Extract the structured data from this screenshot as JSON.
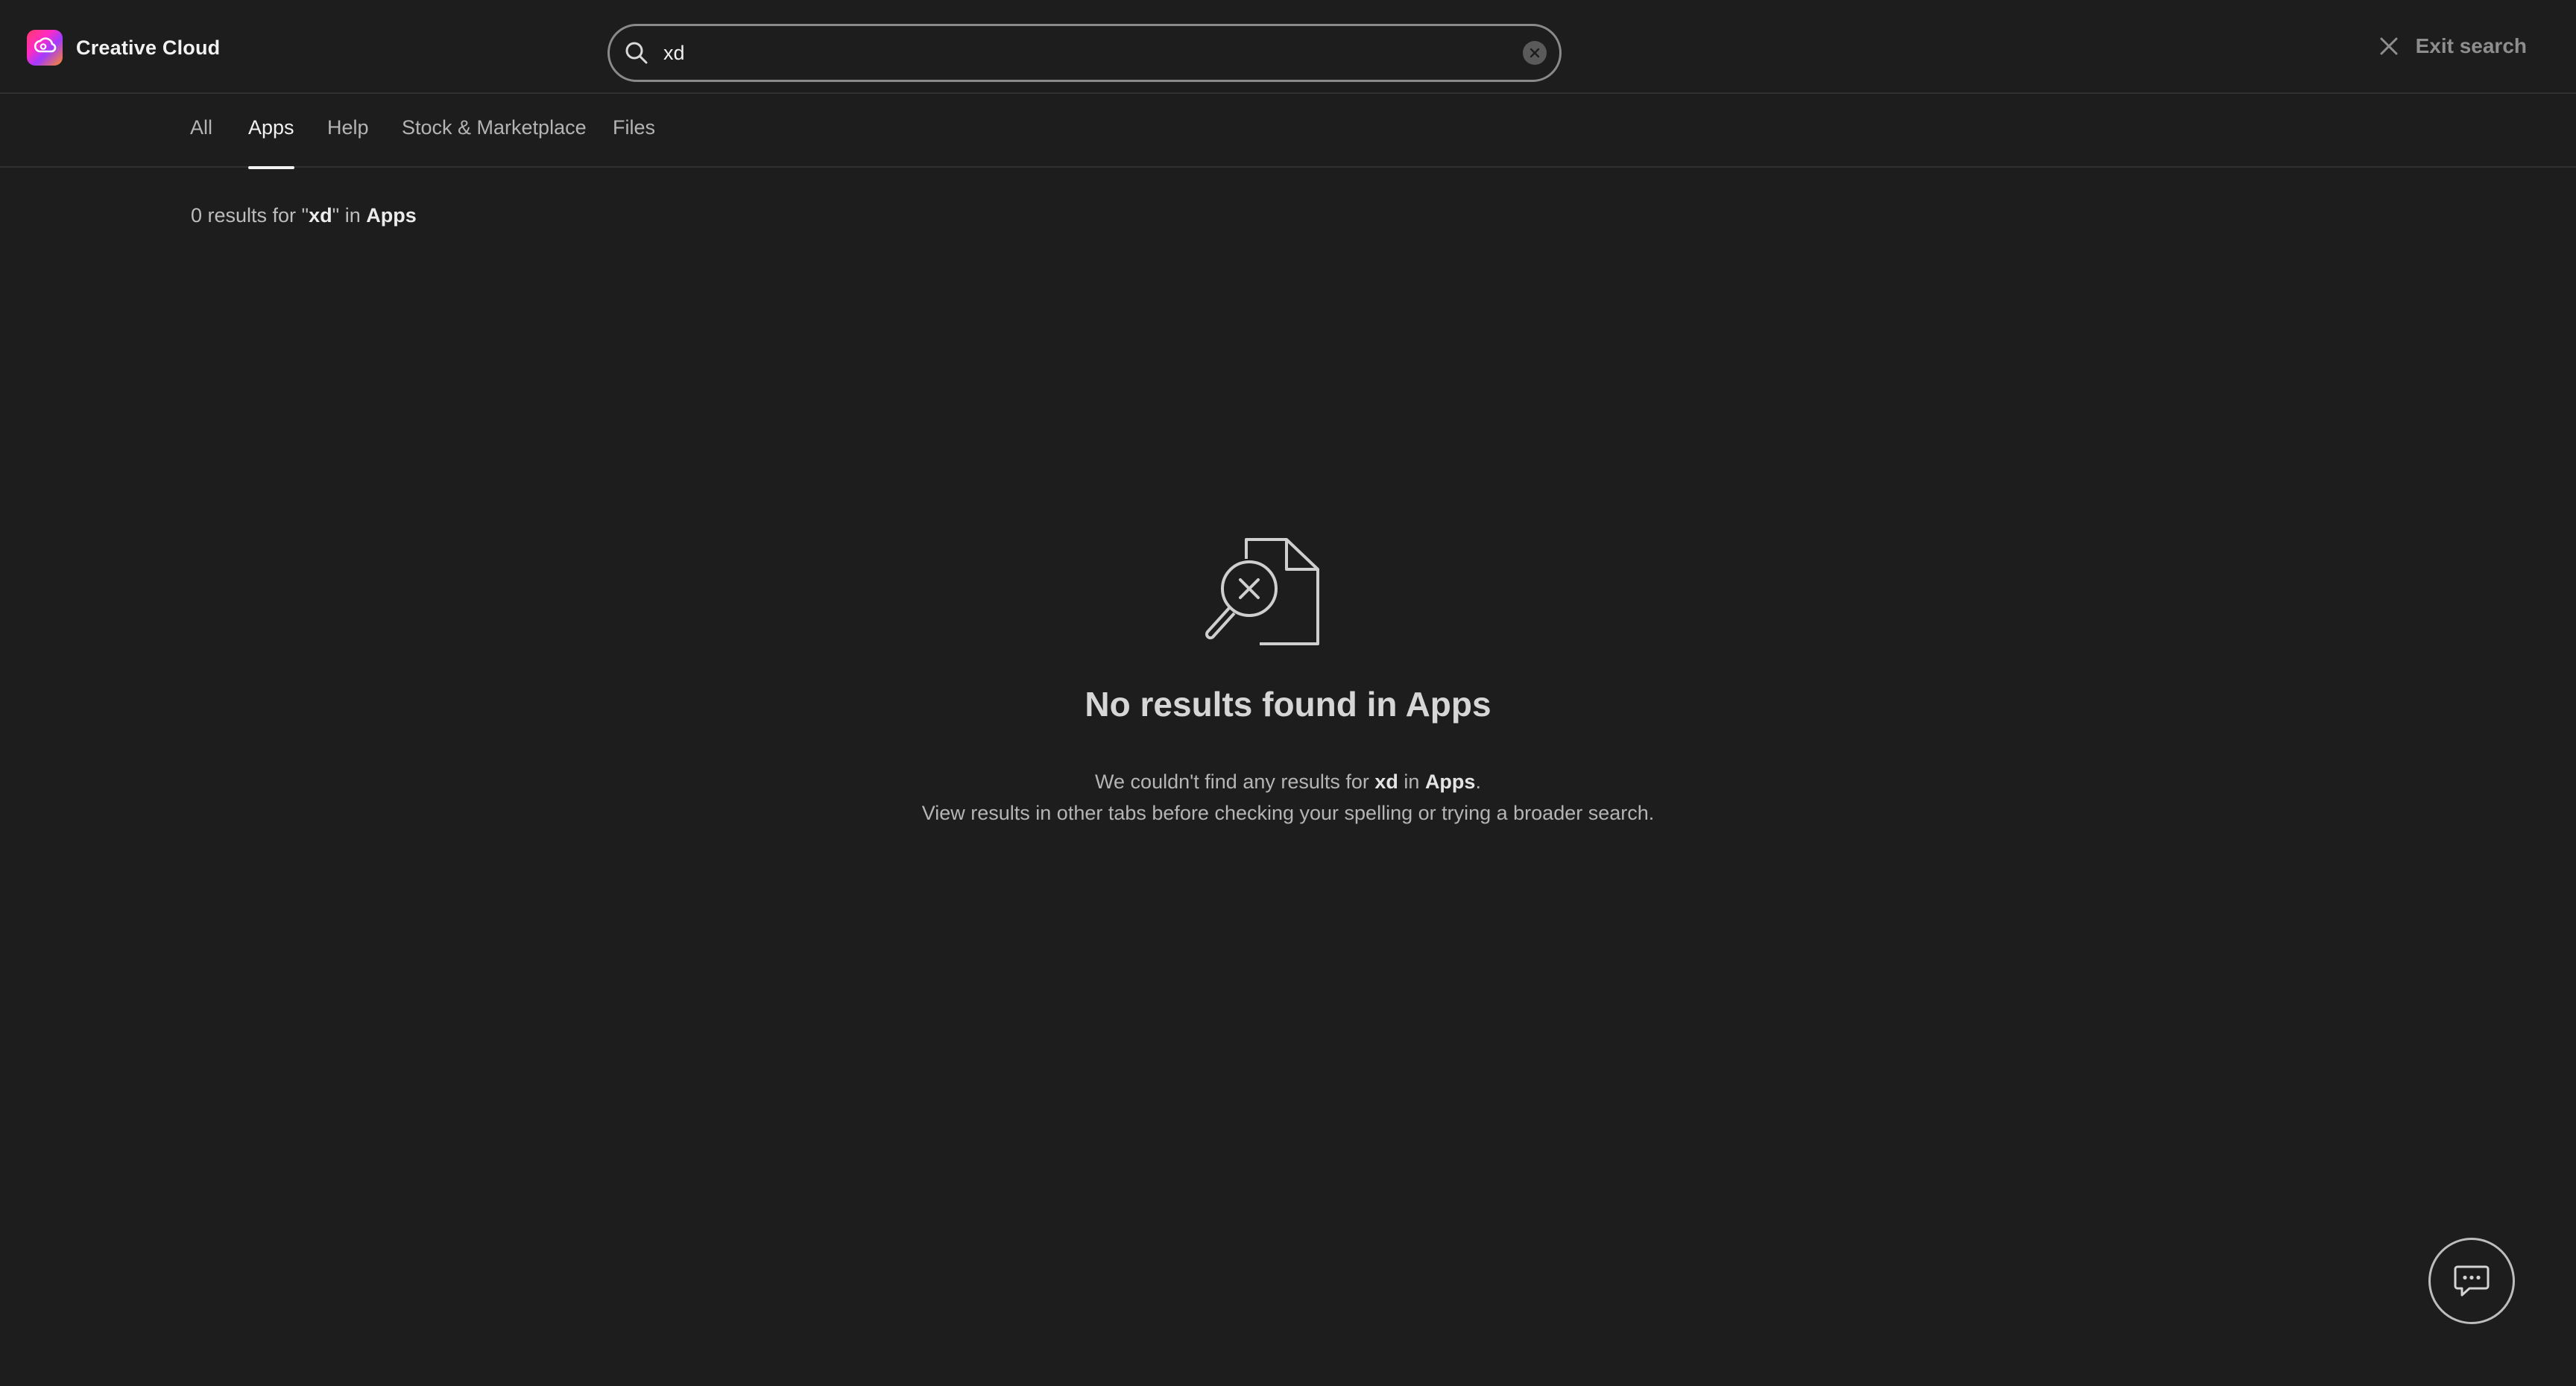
{
  "header": {
    "app_title": "Creative Cloud",
    "logo_icon": "creative-cloud-logo-icon",
    "search": {
      "value": "xd",
      "icon": "search-icon",
      "clear_icon": "clear-icon"
    },
    "exit_search_label": "Exit search"
  },
  "tabs": [
    {
      "label": "All",
      "active": false
    },
    {
      "label": "Apps",
      "active": true
    },
    {
      "label": "Help",
      "active": false
    },
    {
      "label": "Stock & Marketplace",
      "active": false
    },
    {
      "label": "Files",
      "active": false
    }
  ],
  "results_summary": {
    "count_prefix": "0 results for \"",
    "query": "xd",
    "middle": "\" in ",
    "scope": "Apps"
  },
  "empty_state": {
    "icon": "no-results-document-icon",
    "title": "No results found in Apps",
    "line1_prefix": "We couldn't find any results for ",
    "line1_query": "xd",
    "line1_middle": " in ",
    "line1_scope": "Apps",
    "line1_suffix": ".",
    "line2": "View results in other tabs before checking your spelling or trying a broader search."
  },
  "feedback": {
    "icon": "chat-feedback-icon"
  },
  "colors": {
    "background": "#1d1d1d",
    "divider": "#2f2f2f",
    "text_primary": "#f2f2f2",
    "text_secondary": "#b4b4b4"
  }
}
